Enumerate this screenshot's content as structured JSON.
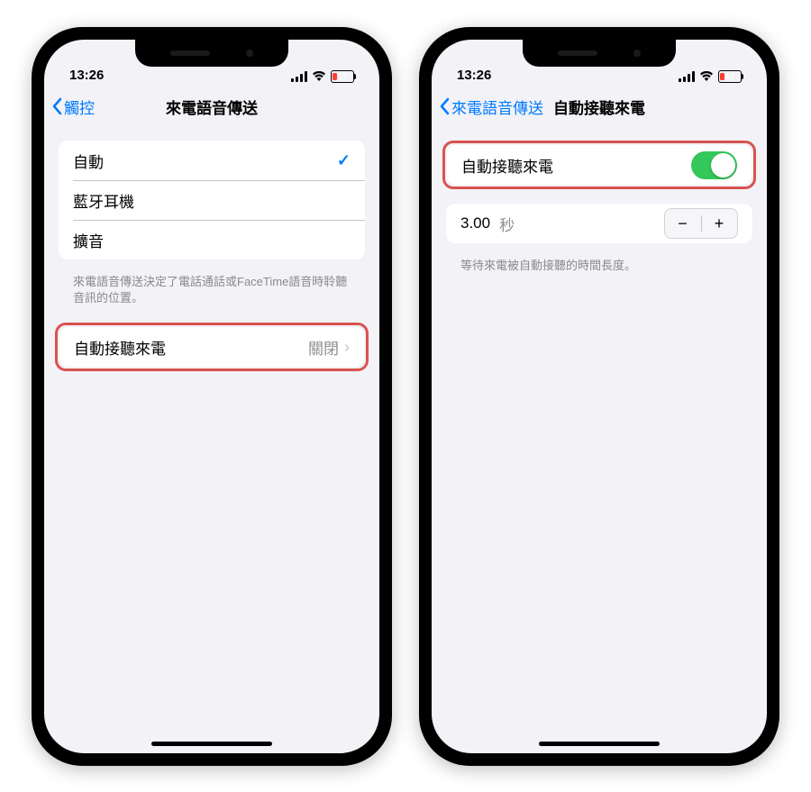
{
  "status": {
    "time": "13:26",
    "battery_percent": "17",
    "battery_low_color": "#ff3b30",
    "battery_fill_pct": 20
  },
  "left": {
    "back_label": "觸控",
    "title": "來電語音傳送",
    "options": {
      "auto": "自動",
      "bluetooth": "藍牙耳機",
      "speaker": "擴音"
    },
    "footer": "來電語音傳送決定了電話通話或FaceTime語音時聆聽音訊的位置。",
    "auto_answer_row": {
      "label": "自動接聽來電",
      "value": "關閉"
    }
  },
  "right": {
    "back_label": "來電語音傳送",
    "title": "自動接聽來電",
    "toggle_label": "自動接聽來電",
    "toggle_on": true,
    "delay_value": "3.00",
    "delay_unit": "秒",
    "footer": "等待來電被自動接聽的時間長度。"
  },
  "glyphs": {
    "check": "✓",
    "chevron_right": "›",
    "minus": "−",
    "plus": "+"
  }
}
